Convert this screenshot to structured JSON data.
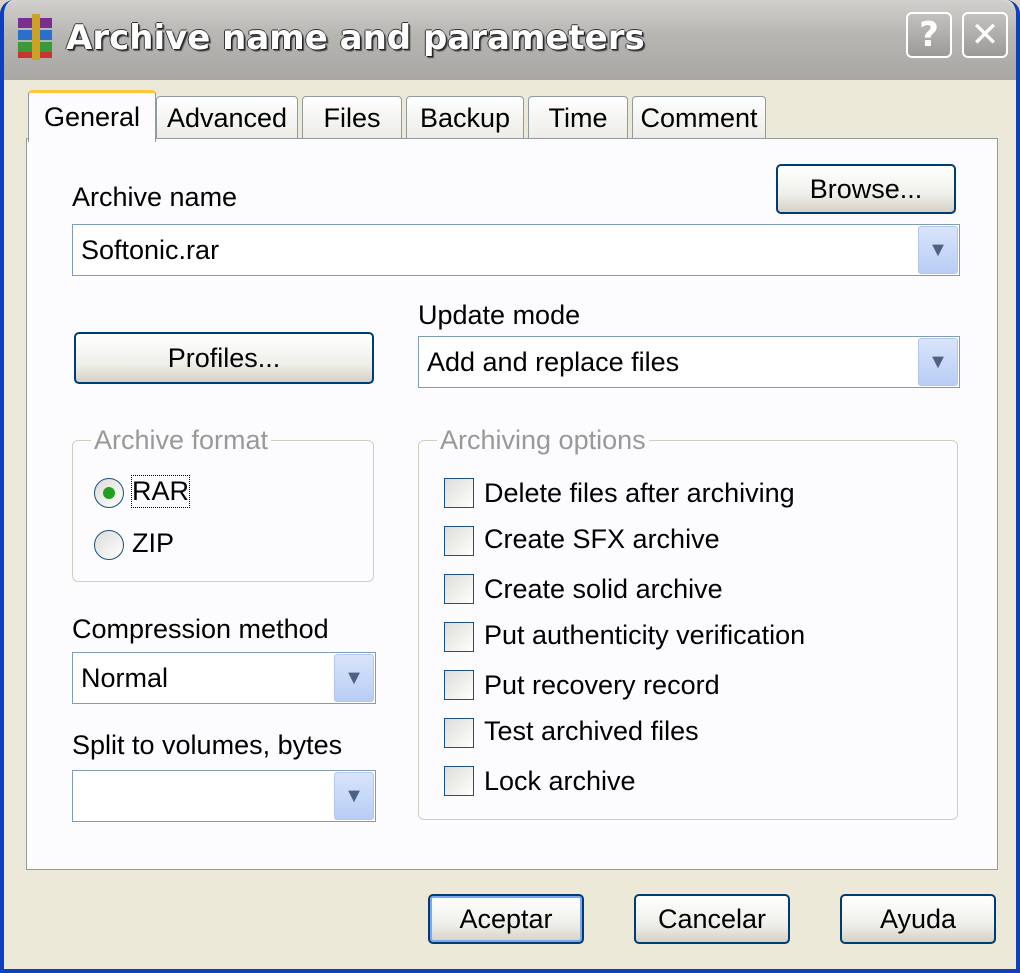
{
  "window": {
    "title": "Archive name and parameters",
    "help_glyph": "?",
    "close_glyph": "✕"
  },
  "tabs": [
    {
      "label": "General",
      "active": true
    },
    {
      "label": "Advanced",
      "active": false
    },
    {
      "label": "Files",
      "active": false
    },
    {
      "label": "Backup",
      "active": false
    },
    {
      "label": "Time",
      "active": false
    },
    {
      "label": "Comment",
      "active": false
    }
  ],
  "general": {
    "archive_name_label": "Archive name",
    "archive_name_value": "Softonic.rar",
    "browse_label": "Browse...",
    "profiles_label": "Profiles...",
    "update_mode_label": "Update mode",
    "update_mode_value": "Add and replace files",
    "archive_format_label": "Archive format",
    "formats": [
      {
        "label": "RAR",
        "selected": true
      },
      {
        "label": "ZIP",
        "selected": false
      }
    ],
    "compression_label": "Compression method",
    "compression_value": "Normal",
    "split_label": "Split to volumes, bytes",
    "split_value": "",
    "options_label": "Archiving options",
    "options": [
      {
        "label": "Delete files after archiving",
        "checked": false
      },
      {
        "label": "Create SFX archive",
        "checked": false
      },
      {
        "label": "Create solid archive",
        "checked": false
      },
      {
        "label": "Put authenticity verification",
        "checked": false
      },
      {
        "label": "Put recovery record",
        "checked": false
      },
      {
        "label": "Test archived files",
        "checked": false
      },
      {
        "label": "Lock archive",
        "checked": false
      }
    ]
  },
  "footer": {
    "ok_label": "Aceptar",
    "cancel_label": "Cancelar",
    "help_label": "Ayuda"
  },
  "icons": {
    "app": "winrar-books-icon",
    "combo_arrow": "chevron-down-icon"
  },
  "colors": {
    "accent": "#003c74",
    "tab_highlight": "#ffc83c",
    "frame": "#0d3fbf"
  }
}
